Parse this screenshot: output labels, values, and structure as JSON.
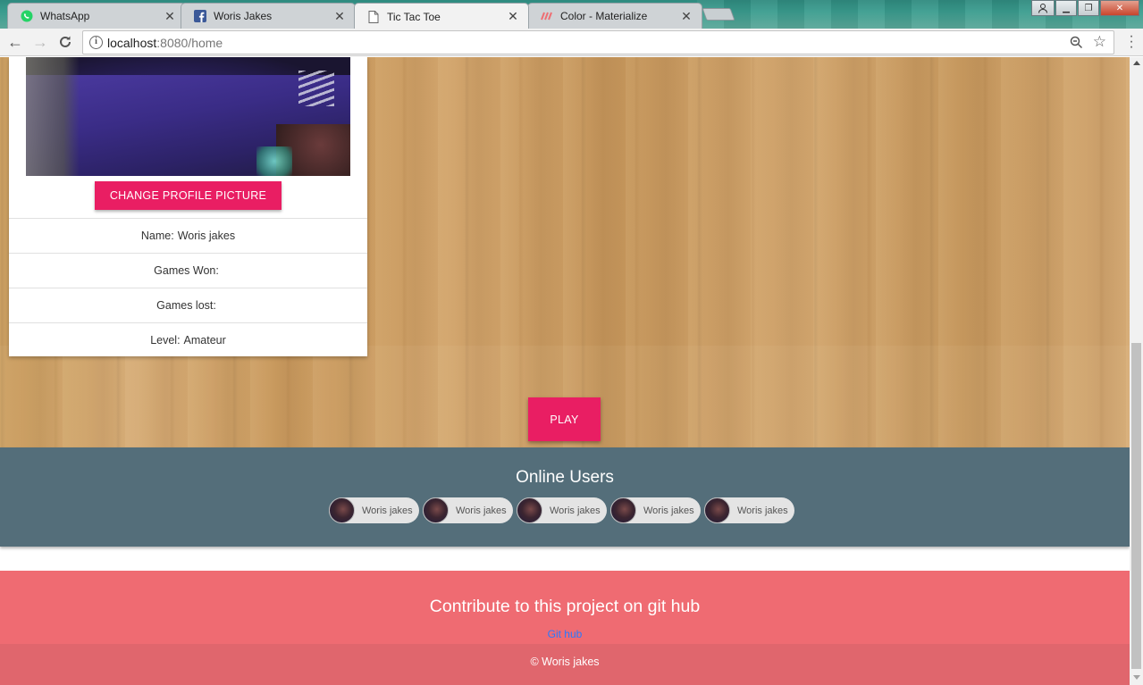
{
  "browser": {
    "tabs": [
      {
        "title": "WhatsApp",
        "icon": "whatsapp-icon",
        "active": false
      },
      {
        "title": "Woris Jakes",
        "icon": "facebook-icon",
        "active": false
      },
      {
        "title": "Tic Tac Toe",
        "icon": "page-icon",
        "active": true
      },
      {
        "title": "Color - Materialize",
        "icon": "materialize-icon",
        "active": false
      }
    ],
    "url_host": "localhost",
    "url_path": ":8080/home"
  },
  "profile": {
    "change_picture_label": "Change Profile Picture",
    "rows": [
      {
        "label": "Name:",
        "value": "Woris jakes"
      },
      {
        "label": "Games Won:",
        "value": ""
      },
      {
        "label": "Games lost:",
        "value": ""
      },
      {
        "label": "Level:",
        "value": "Amateur"
      }
    ]
  },
  "play_label": "Play",
  "online": {
    "title": "Online Users",
    "users": [
      "Woris jakes",
      "Woris jakes",
      "Woris jakes",
      "Woris jakes",
      "Woris jakes"
    ]
  },
  "footer": {
    "title": "Contribute to this project on git hub",
    "link": "Git hub",
    "copyright": "© Woris jakes"
  },
  "colors": {
    "accent": "#e91e63",
    "online_bg": "#546e7a",
    "footer_bg": "#ef6b72",
    "footer_bottom_bg": "#e0666d",
    "link": "#2979ff"
  }
}
